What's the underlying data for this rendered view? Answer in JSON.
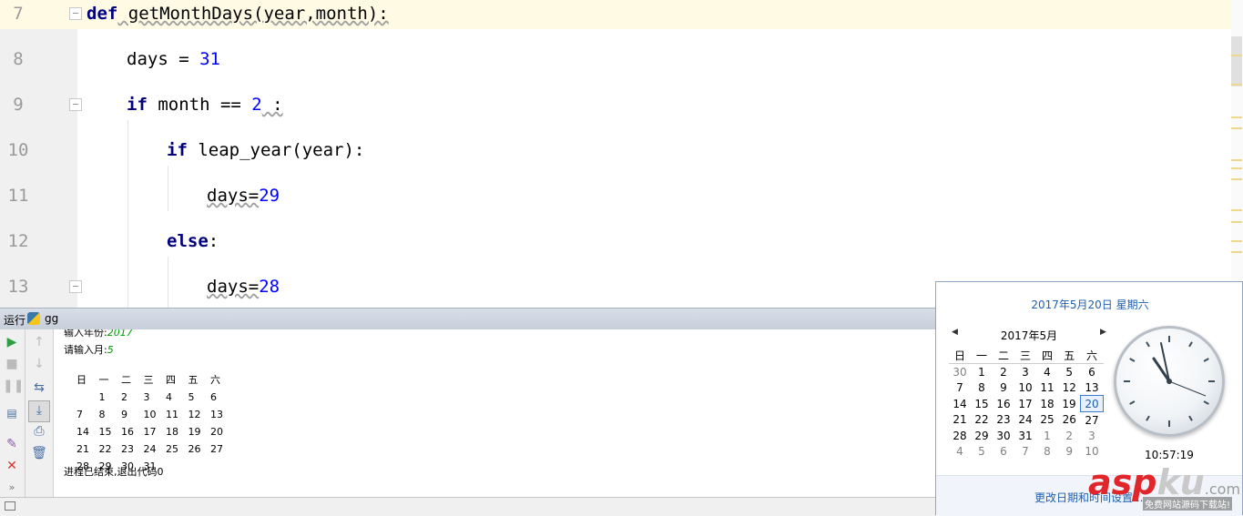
{
  "editor": {
    "lines": [
      {
        "num": "7"
      },
      {
        "num": "8"
      },
      {
        "num": "9"
      },
      {
        "num": "10"
      },
      {
        "num": "11"
      },
      {
        "num": "12"
      },
      {
        "num": "13"
      }
    ],
    "code": {
      "l7_kw": "def",
      "l7_rest": " getMonthDays(year,month):",
      "l8_var": "days = ",
      "l8_num": "31",
      "l9_kw": "if",
      "l9_mid": " month == ",
      "l9_num": "2",
      "l9_end": " :",
      "l10_kw": "if",
      "l10_rest": " leap_year(year):",
      "l11_var": "days=",
      "l11_num": "29",
      "l12_kw": "else",
      "l12_end": ":",
      "l13_var": "days=",
      "l13_num": "28"
    }
  },
  "run_panel": {
    "tab_label": "运行",
    "config_name": "gg",
    "console": {
      "year_prompt": "输入年份:",
      "year_value": "2017",
      "month_prompt": "请输入月:",
      "month_value": "5",
      "weekday_header": [
        "日",
        "一",
        "二",
        "三",
        "四",
        "五",
        "六"
      ],
      "weeks": [
        [
          "",
          "1",
          "2",
          "3",
          "4",
          "5",
          "6"
        ],
        [
          "7",
          "8",
          "9",
          "10",
          "11",
          "12",
          "13"
        ],
        [
          "14",
          "15",
          "16",
          "17",
          "18",
          "19",
          "20"
        ],
        [
          "21",
          "22",
          "23",
          "24",
          "25",
          "26",
          "27"
        ],
        [
          "28",
          "29",
          "30",
          "31",
          "",
          "",
          ""
        ]
      ],
      "exit_message": "进程已结束,退出代码0"
    }
  },
  "calendar_popup": {
    "date_link": "2017年5月20日 星期六",
    "month_title": "2017年5月",
    "weekday_header": [
      "日",
      "一",
      "二",
      "三",
      "四",
      "五",
      "六"
    ],
    "rows": [
      [
        "30",
        "1",
        "2",
        "3",
        "4",
        "5",
        "6"
      ],
      [
        "7",
        "8",
        "9",
        "10",
        "11",
        "12",
        "13"
      ],
      [
        "14",
        "15",
        "16",
        "17",
        "18",
        "19",
        "20"
      ],
      [
        "21",
        "22",
        "23",
        "24",
        "25",
        "26",
        "27"
      ],
      [
        "28",
        "29",
        "30",
        "31",
        "1",
        "2",
        "3"
      ],
      [
        "4",
        "5",
        "6",
        "7",
        "8",
        "9",
        "10"
      ]
    ],
    "today": "20",
    "time": "10:57:19",
    "settings_link": "更改日期和时间设置..."
  },
  "watermark": {
    "brand_red": "asp",
    "brand_gray": "ku",
    "domain": ".com",
    "tagline": "免费网站源码下载站!"
  },
  "colors": {
    "keyword": "#000080",
    "number": "#0000ff",
    "current_line": "#fffae3",
    "link": "#1e5fb3"
  }
}
